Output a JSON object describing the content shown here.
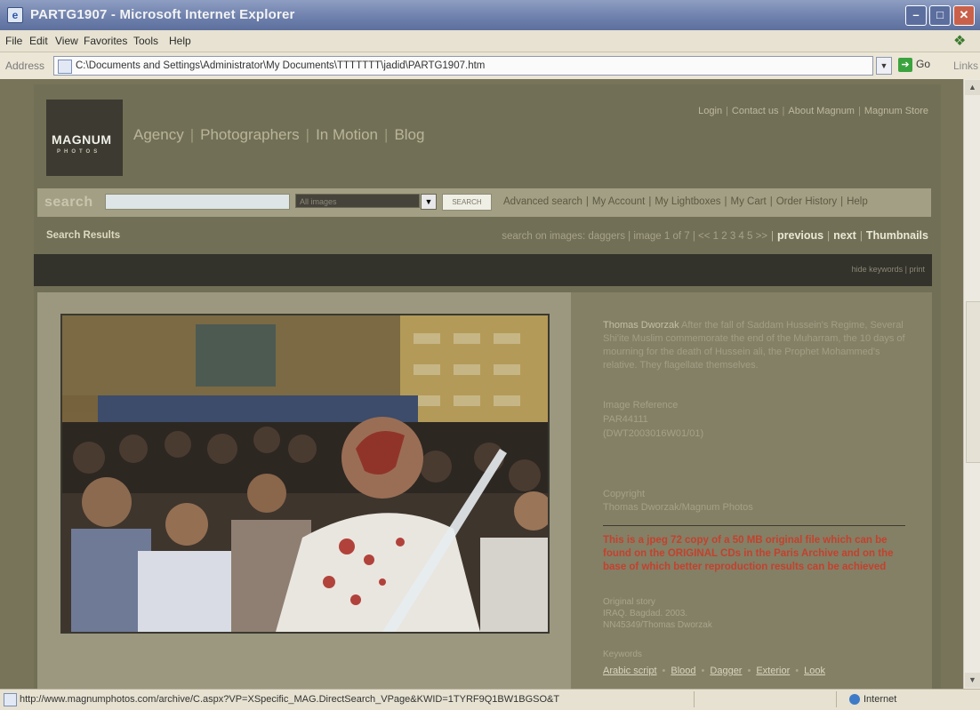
{
  "window": {
    "title": "PARTG1907 - Microsoft Internet Explorer",
    "buttons": {
      "minimize": "–",
      "maximize": "□",
      "close": "✕"
    }
  },
  "menu": [
    "File",
    "Edit",
    "View",
    "Favorites",
    "Tools",
    "Help"
  ],
  "address": {
    "label": "Address",
    "url": "C:\\Documents and Settings\\Administrator\\My Documents\\TTTTTTT\\jadid\\PARTG1907.htm",
    "go": "Go",
    "links": "Links"
  },
  "site": {
    "logo": "MAGNUM",
    "logo_sub": "PHOTOS",
    "nav": [
      "Agency",
      "Photographers",
      "In Motion",
      "Blog"
    ],
    "utility": [
      "Login",
      "Contact us",
      "About Magnum",
      "Magnum Store"
    ],
    "search": {
      "label": "search",
      "input_value": "",
      "select_value": "All images",
      "button": "SEARCH",
      "links": [
        "Advanced search",
        "My Account",
        "My Lightboxes",
        "My Cart",
        "Order History",
        "Help"
      ]
    },
    "results": {
      "label": "Search Results",
      "info": "search on images: daggers | image 1 of 7 | << 1 2 3 4 5 >>",
      "previous": "previous",
      "next": "next",
      "thumbnails": "Thumbnails"
    },
    "band": {
      "hide_keywords": "hide keywords",
      "print": "print"
    },
    "detail": {
      "author": "Thomas Dworzak",
      "caption": "After the fall of Saddam Hussein's Regime, Several Shi'ite Muslim commemorate the end of the Muharram, the 10 days of mourning for the death of Hussein ali, the Prophet Mohammed's relative. They flagellate themselves.",
      "image_ref_label": "Image Reference",
      "image_ref": "PAR44111",
      "image_ref2": "(DWT2003016W01/01)",
      "copyright_label": "Copyright",
      "copyright": "Thomas Dworzak/Magnum Photos",
      "warning": "This is a jpeg 72 copy of a 50 MB original file which can be found on the ORIGINAL CDs in the Paris Archive and on the base of which better reproduction results can be achieved",
      "original_story_label": "Original story",
      "original_story": "IRAQ. Bagdad. 2003.",
      "original_story2": "NN45349/Thomas Dworzak",
      "keywords_label": "Keywords",
      "keywords": [
        "Arabic script",
        "Blood",
        "Dagger",
        "Exterior",
        "Look"
      ]
    }
  },
  "status": {
    "url": "http://www.magnumphotos.com/archive/C.aspx?VP=XSpecific_MAG.DirectSearch_VPage&KWID=1TYRF9Q1BW1BGSO&T",
    "zone": "Internet"
  },
  "colors": {
    "title_bar": "#6f81ad",
    "site_background": "#716f55",
    "warning_text": "#c4412d"
  }
}
